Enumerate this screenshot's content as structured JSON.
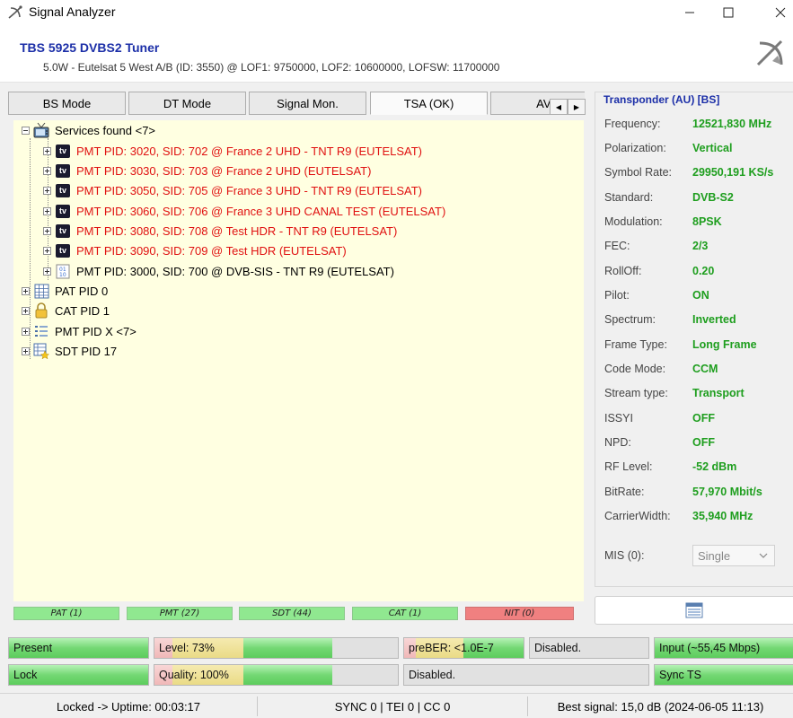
{
  "window": {
    "title": "Signal Analyzer",
    "icon": "satellite-dish-icon"
  },
  "header": {
    "device": "TBS 5925 DVBS2 Tuner",
    "subline": "5.0W - Eutelsat 5 West A/B (ID: 3550) @ LOF1: 9750000, LOF2: 10600000, LOFSW: 11700000",
    "logo": "satellite-logo-icon"
  },
  "tabs": [
    {
      "label": "BS Mode"
    },
    {
      "label": "DT Mode"
    },
    {
      "label": "Signal Mon."
    },
    {
      "label": "TSA (OK)"
    },
    {
      "label": "AV P"
    }
  ],
  "tree": {
    "root": {
      "label": "Services found <7>",
      "icon": "tv-antenna-icon"
    },
    "services": [
      {
        "label": "PMT PID: 3020, SID: 702 @ France 2 UHD - TNT R9 (EUTELSAT)",
        "icon": "tv-icon"
      },
      {
        "label": "PMT PID: 3030, SID: 703 @ France 2 UHD (EUTELSAT)",
        "icon": "tv-icon"
      },
      {
        "label": "PMT PID: 3050, SID: 705 @ France 3 UHD - TNT R9 (EUTELSAT)",
        "icon": "tv-icon"
      },
      {
        "label": "PMT PID: 3060, SID: 706 @ France 3 UHD CANAL TEST (EUTELSAT)",
        "icon": "tv-icon"
      },
      {
        "label": "PMT PID: 3080, SID: 708 @ Test HDR - TNT R9 (EUTELSAT)",
        "icon": "tv-icon"
      },
      {
        "label": "PMT PID: 3090, SID: 709 @ Test HDR (EUTELSAT)",
        "icon": "tv-icon"
      },
      {
        "label": "PMT PID: 3000, SID: 700 @ DVB-SIS - TNT R9 (EUTELSAT)",
        "icon": "data-icon"
      }
    ],
    "tables": [
      {
        "label": "PAT PID 0",
        "icon": "grid-table-icon"
      },
      {
        "label": "CAT PID 1",
        "icon": "lock-icon"
      },
      {
        "label": "PMT PID X <7>",
        "icon": "list-icon"
      },
      {
        "label": "SDT PID 17",
        "icon": "star-table-icon"
      }
    ]
  },
  "pid_strip": [
    {
      "label": "PAT (1)"
    },
    {
      "label": "PMT (27)"
    },
    {
      "label": "SDT (44)"
    },
    {
      "label": "CAT (1)"
    },
    {
      "label": "NIT (0)"
    }
  ],
  "transponder": {
    "title": "Transponder (AU) [BS]",
    "rows": [
      {
        "label": "Frequency:",
        "value": "12521,830 MHz"
      },
      {
        "label": "Polarization:",
        "value": "Vertical"
      },
      {
        "label": "Symbol Rate:",
        "value": "29950,191 KS/s"
      },
      {
        "label": "Standard:",
        "value": "DVB-S2"
      },
      {
        "label": "Modulation:",
        "value": "8PSK"
      },
      {
        "label": "FEC:",
        "value": "2/3"
      },
      {
        "label": "RollOff:",
        "value": "0.20"
      },
      {
        "label": "Pilot:",
        "value": "ON"
      },
      {
        "label": "Spectrum:",
        "value": "Inverted"
      },
      {
        "label": "Frame Type:",
        "value": "Long Frame"
      },
      {
        "label": "Code Mode:",
        "value": "CCM"
      },
      {
        "label": "Stream type:",
        "value": "Transport"
      },
      {
        "label": "ISSYI",
        "value": "OFF"
      },
      {
        "label": "NPD:",
        "value": "OFF"
      },
      {
        "label": "RF Level:",
        "value": "-52 dBm"
      },
      {
        "label": "BitRate:",
        "value": "57,970 Mbit/s"
      },
      {
        "label": "CarrierWidth:",
        "value": "35,940 MHz"
      }
    ],
    "mis_label": "MIS (0):",
    "mis_value": "Single"
  },
  "indicators": {
    "present": "Present",
    "lock": "Lock",
    "level": "Level: 73%",
    "level_fraction": 0.73,
    "quality": "Quality: 100%",
    "quality_fraction": 0.73,
    "preber": "preBER: <1.0E-7",
    "disabled1": "Disabled.",
    "disabled2": "Disabled.",
    "input": "Input (~55,45 Mbps)",
    "sync": "Sync TS"
  },
  "statusbar": {
    "uptime": "Locked -> Uptime: 00:03:17",
    "counters": "SYNC 0 | TEI 0 | CC 0",
    "best": "Best signal: 15,0 dB (2024-06-05 11:13)"
  },
  "colors": {
    "accent": "#1c2fa8",
    "value_green": "#1e9e1e",
    "service_red": "#e01010",
    "tree_bg": "#ffffe1"
  }
}
